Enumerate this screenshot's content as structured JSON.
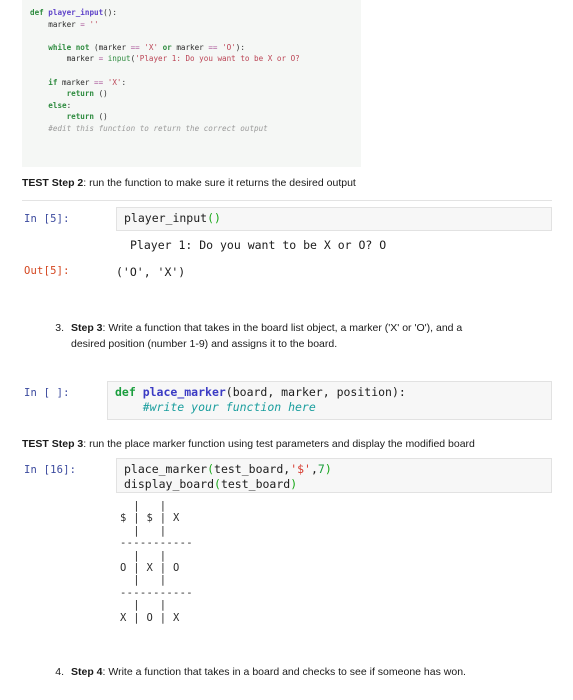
{
  "document": {
    "kind": "jupyter-notebook-page",
    "colors": {
      "in_prompt": "#3b4a9e",
      "out_prompt": "#d4461f",
      "input_background": "#f7f7f7",
      "input_border": "#e2e2e2",
      "snippet_background": "#f5f7f5",
      "page_background": "#ffffff"
    }
  },
  "top_snippet": {
    "name": "player_input-source-snippet",
    "lines": [
      [
        {
          "t": "def ",
          "c": "k-def"
        },
        {
          "t": "player_input",
          "c": "k-fn"
        },
        {
          "t": "():",
          "c": "k-plain"
        }
      ],
      [
        {
          "t": "    marker ",
          "c": "k-plain"
        },
        {
          "t": "= ",
          "c": "k-op"
        },
        {
          "t": "''",
          "c": "k-str"
        }
      ],
      [
        {
          "t": "",
          "c": "k-plain"
        }
      ],
      [
        {
          "t": "    ",
          "c": "k-plain"
        },
        {
          "t": "while not ",
          "c": "k-kw"
        },
        {
          "t": "(marker ",
          "c": "k-plain"
        },
        {
          "t": "== ",
          "c": "k-op"
        },
        {
          "t": "'X' ",
          "c": "k-str"
        },
        {
          "t": "or ",
          "c": "k-kw"
        },
        {
          "t": "marker ",
          "c": "k-plain"
        },
        {
          "t": "== ",
          "c": "k-op"
        },
        {
          "t": "'O'",
          "c": "k-str"
        },
        {
          "t": "):",
          "c": "k-plain"
        }
      ],
      [
        {
          "t": "        marker ",
          "c": "k-plain"
        },
        {
          "t": "= ",
          "c": "k-op"
        },
        {
          "t": "input",
          "c": "k-builtin"
        },
        {
          "t": "(",
          "c": "k-plain"
        },
        {
          "t": "'Player 1: Do you want to be X or O?",
          "c": "k-str"
        }
      ],
      [
        {
          "t": "",
          "c": "k-plain"
        }
      ],
      [
        {
          "t": "    ",
          "c": "k-plain"
        },
        {
          "t": "if ",
          "c": "k-kw"
        },
        {
          "t": "marker ",
          "c": "k-plain"
        },
        {
          "t": "== ",
          "c": "k-op"
        },
        {
          "t": "'X'",
          "c": "k-str"
        },
        {
          "t": ":",
          "c": "k-plain"
        }
      ],
      [
        {
          "t": "        ",
          "c": "k-plain"
        },
        {
          "t": "return ",
          "c": "k-kw"
        },
        {
          "t": "()",
          "c": "k-plain"
        }
      ],
      [
        {
          "t": "    ",
          "c": "k-plain"
        },
        {
          "t": "else",
          "c": "k-kw"
        },
        {
          "t": ":",
          "c": "k-plain"
        }
      ],
      [
        {
          "t": "        ",
          "c": "k-plain"
        },
        {
          "t": "return ",
          "c": "k-kw"
        },
        {
          "t": "()",
          "c": "k-plain"
        }
      ],
      [
        {
          "t": "    #edit this function to return the correct output",
          "c": "k-com"
        }
      ]
    ]
  },
  "test_step_2": {
    "label": "TEST Step 2",
    "text": ": run the function to make sure it returns the desired output"
  },
  "cell_in_5": {
    "prompt": "In [5]:",
    "code_lines": [
      [
        {
          "t": "player_input",
          "c": "c-name"
        },
        {
          "t": "()",
          "c": "c-paren"
        }
      ]
    ],
    "stdout": "Player 1: Do you want to be X or O? O"
  },
  "cell_out_5": {
    "prompt": "Out[5]:",
    "value": "('O', 'X')"
  },
  "step_3": {
    "number": "3.",
    "label": "Step 3",
    "text_line_1": ": Write a function that takes in the board list object, a marker ('X' or 'O'), and a",
    "text_line_2": "desired position (number 1-9) and assigns it to the board."
  },
  "cell_in_blank": {
    "prompt": "In [ ]:",
    "code_lines": [
      [
        {
          "t": "def ",
          "c": "c-def"
        },
        {
          "t": "place_marker",
          "c": "c-fname"
        },
        {
          "t": "(board, marker, position):",
          "c": "c-name"
        }
      ],
      [
        {
          "t": "    #write your function here",
          "c": "c-comment"
        }
      ]
    ]
  },
  "test_step_3": {
    "label": "TEST Step 3",
    "text": ": run the place marker function using test parameters and display the modified board"
  },
  "cell_in_16": {
    "prompt": "In [16]:",
    "code_lines": [
      [
        {
          "t": "place_marker",
          "c": "c-name"
        },
        {
          "t": "(",
          "c": "c-paren"
        },
        {
          "t": "test_board,",
          "c": "c-name"
        },
        {
          "t": "'$'",
          "c": "c-str"
        },
        {
          "t": ",",
          "c": "c-name"
        },
        {
          "t": "7",
          "c": "c-num"
        },
        {
          "t": ")",
          "c": "c-paren"
        }
      ],
      [
        {
          "t": "display_board",
          "c": "c-name"
        },
        {
          "t": "(",
          "c": "c-paren"
        },
        {
          "t": "test_board",
          "c": "c-name"
        },
        {
          "t": ")",
          "c": "c-paren"
        }
      ]
    ],
    "board_output": [
      "  |   |",
      "$ | $ | X",
      "  |   |",
      "-----------",
      "  |   |",
      "O | X | O",
      "  |   |",
      "-----------",
      "  |   |",
      "X | O | X"
    ],
    "board_grid": [
      [
        "$",
        "$",
        "X"
      ],
      [
        "O",
        "X",
        "O"
      ],
      [
        "X",
        "O",
        "X"
      ]
    ]
  },
  "step_4": {
    "number": "4.",
    "label": "Step 4",
    "text": ": Write a function that takes in a board and checks to see if someone has won."
  }
}
